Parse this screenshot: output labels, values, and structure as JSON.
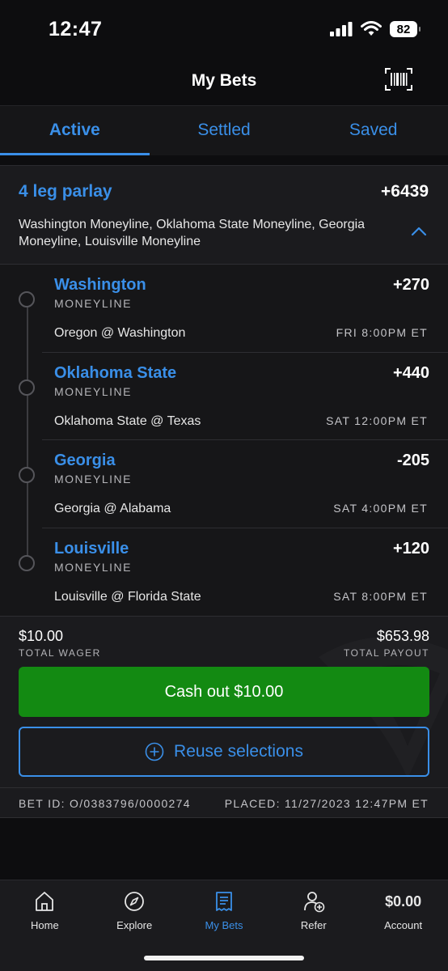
{
  "status_bar": {
    "time": "12:47",
    "battery": "82"
  },
  "header": {
    "title": "My Bets"
  },
  "tabs": [
    {
      "label": "Active",
      "active": true
    },
    {
      "label": "Settled",
      "active": false
    },
    {
      "label": "Saved",
      "active": false
    }
  ],
  "bet": {
    "title": "4 leg parlay",
    "odds": "+6439",
    "description": "Washington Moneyline, Oklahoma State Moneyline, Georgia Moneyline, Louisville Moneyline",
    "legs": [
      {
        "team": "Washington",
        "type": "MONEYLINE",
        "odds": "+270",
        "matchup": "Oregon @ Washington",
        "time": "FRI 8:00PM ET"
      },
      {
        "team": "Oklahoma State",
        "type": "MONEYLINE",
        "odds": "+440",
        "matchup": "Oklahoma State @ Texas",
        "time": "SAT 12:00PM ET"
      },
      {
        "team": "Georgia",
        "type": "MONEYLINE",
        "odds": "-205",
        "matchup": "Georgia @ Alabama",
        "time": "SAT 4:00PM ET"
      },
      {
        "team": "Louisville",
        "type": "MONEYLINE",
        "odds": "+120",
        "matchup": "Louisville @ Florida State",
        "time": "SAT 8:00PM ET"
      }
    ],
    "total_wager": "$10.00",
    "total_wager_label": "TOTAL WAGER",
    "total_payout": "$653.98",
    "total_payout_label": "TOTAL PAYOUT",
    "cashout_label": "Cash out $10.00",
    "reuse_label": "Reuse selections",
    "bet_id": "BET ID: O/0383796/0000274",
    "placed": "PLACED: 11/27/2023 12:47PM ET"
  },
  "nav": {
    "home": "Home",
    "explore": "Explore",
    "mybets": "My Bets",
    "refer": "Refer",
    "balance": "$0.00",
    "account": "Account"
  },
  "colors": {
    "accent": "#3a8fe8",
    "cashout": "#138a12",
    "background": "#0d0d0f"
  }
}
